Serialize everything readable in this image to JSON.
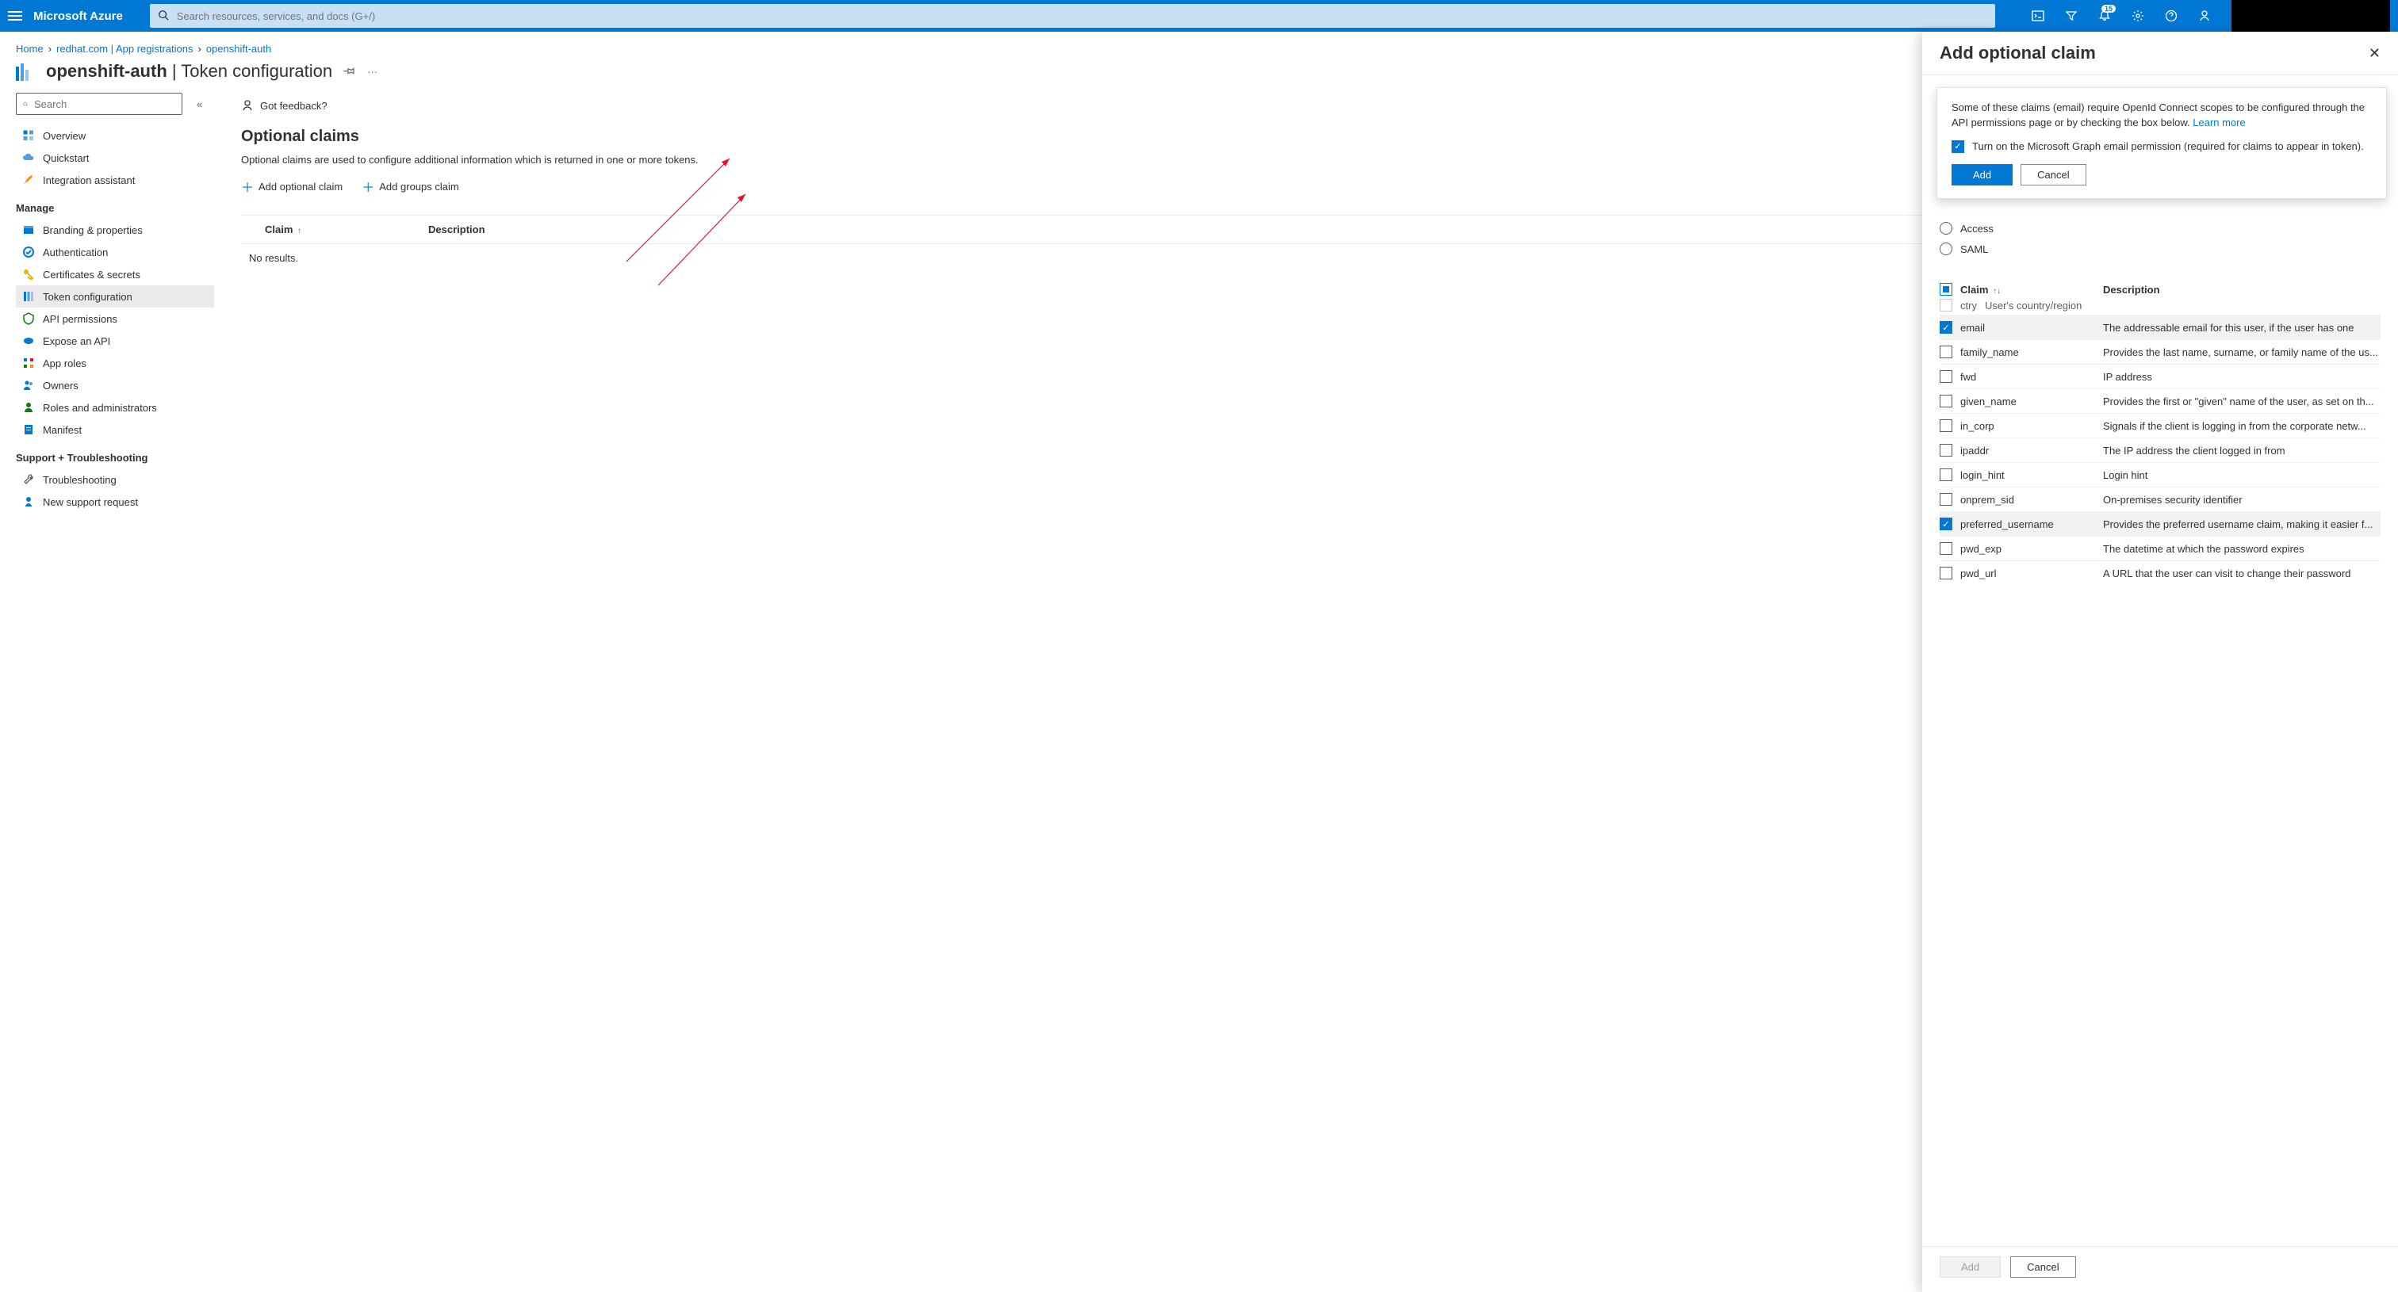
{
  "topbar": {
    "brand": "Microsoft Azure",
    "search_placeholder": "Search resources, services, and docs (G+/)",
    "notification_count": "15"
  },
  "breadcrumbs": {
    "home": "Home",
    "item1": "redhat.com | App registrations",
    "item2": "openshift-auth"
  },
  "page_title": {
    "app_name": "openshift-auth",
    "suffix": " | Token configuration"
  },
  "side_search_placeholder": "Search",
  "nav": {
    "overview": "Overview",
    "quickstart": "Quickstart",
    "integration": "Integration assistant",
    "manage": "Manage",
    "branding": "Branding & properties",
    "authentication": "Authentication",
    "certs": "Certificates & secrets",
    "token": "Token configuration",
    "apiperm": "API permissions",
    "expose": "Expose an API",
    "approles": "App roles",
    "owners": "Owners",
    "roles": "Roles and administrators",
    "manifest": "Manifest",
    "support": "Support + Troubleshooting",
    "troubleshoot": "Troubleshooting",
    "newreq": "New support request"
  },
  "main": {
    "feedback": "Got feedback?",
    "h2": "Optional claims",
    "desc": "Optional claims are used to configure additional information which is returned in one or more tokens.",
    "add_optional": "Add optional claim",
    "add_groups": "Add groups claim",
    "col_claim": "Claim",
    "col_desc": "Description",
    "no_results": "No results."
  },
  "panel": {
    "title": "Add optional claim",
    "callout_text": "Some of these claims (email) require OpenId Connect scopes to be configured through the API permissions page or by checking the box below. ",
    "learn_more": "Learn more",
    "checkbox_label": "Turn on the Microsoft Graph email permission (required for claims to appear in token).",
    "add": "Add",
    "cancel": "Cancel",
    "radio_access": "Access",
    "radio_saml": "SAML",
    "col_claim": "Claim",
    "col_desc": "Description",
    "claims": [
      {
        "name": "ctry",
        "desc": "User's country/region",
        "checked": false,
        "partial": true
      },
      {
        "name": "email",
        "desc": "The addressable email for this user, if the user has one",
        "checked": true
      },
      {
        "name": "family_name",
        "desc": "Provides the last name, surname, or family name of the us...",
        "checked": false
      },
      {
        "name": "fwd",
        "desc": "IP address",
        "checked": false
      },
      {
        "name": "given_name",
        "desc": "Provides the first or \"given\" name of the user, as set on th...",
        "checked": false
      },
      {
        "name": "in_corp",
        "desc": "Signals if the client is logging in from the corporate netw...",
        "checked": false
      },
      {
        "name": "ipaddr",
        "desc": "The IP address the client logged in from",
        "checked": false
      },
      {
        "name": "login_hint",
        "desc": "Login hint",
        "checked": false
      },
      {
        "name": "onprem_sid",
        "desc": "On-premises security identifier",
        "checked": false
      },
      {
        "name": "preferred_username",
        "desc": "Provides the preferred username claim, making it easier f...",
        "checked": true
      },
      {
        "name": "pwd_exp",
        "desc": "The datetime at which the password expires",
        "checked": false
      },
      {
        "name": "pwd_url",
        "desc": "A URL that the user can visit to change their password",
        "checked": false
      }
    ],
    "footer_add": "Add",
    "footer_cancel": "Cancel"
  }
}
